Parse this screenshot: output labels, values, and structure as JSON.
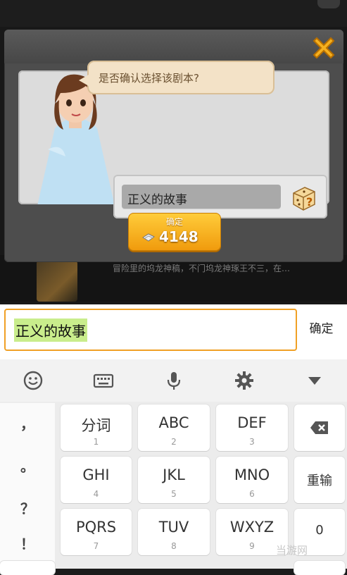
{
  "dialog": {
    "prompt": "是否确认选择该剧本?",
    "script_name": "正义的故事",
    "confirm_label": "确定",
    "cost": "4148"
  },
  "background": {
    "row_text": "冒险里的坞龙神稿，不门坞龙神琢王不三，在…"
  },
  "input": {
    "value": "正义的故事",
    "confirm_label": "确定"
  },
  "keyboard": {
    "toolbar": [
      "emoji-icon",
      "keyboard-icon",
      "microphone-icon",
      "gear-icon",
      "collapse-icon"
    ],
    "symbols": [
      "，",
      "。",
      "？",
      "！"
    ],
    "rows": [
      [
        {
          "main": "分词",
          "sub": "1"
        },
        {
          "main": "ABC",
          "sub": "2"
        },
        {
          "main": "DEF",
          "sub": "3"
        }
      ],
      [
        {
          "main": "GHI",
          "sub": "4"
        },
        {
          "main": "JKL",
          "sub": "5"
        },
        {
          "main": "MNO",
          "sub": "6"
        }
      ],
      [
        {
          "main": "PQRS",
          "sub": "7"
        },
        {
          "main": "TUV",
          "sub": "8"
        },
        {
          "main": "WXYZ",
          "sub": "9"
        }
      ]
    ],
    "side": {
      "backspace": "backspace-icon",
      "reenter": "重输",
      "zero": "0"
    }
  },
  "watermark": "当游网",
  "colors": {
    "accent": "#f0a025",
    "button": "#f5b01f",
    "highlight": "#c9ed8c"
  }
}
